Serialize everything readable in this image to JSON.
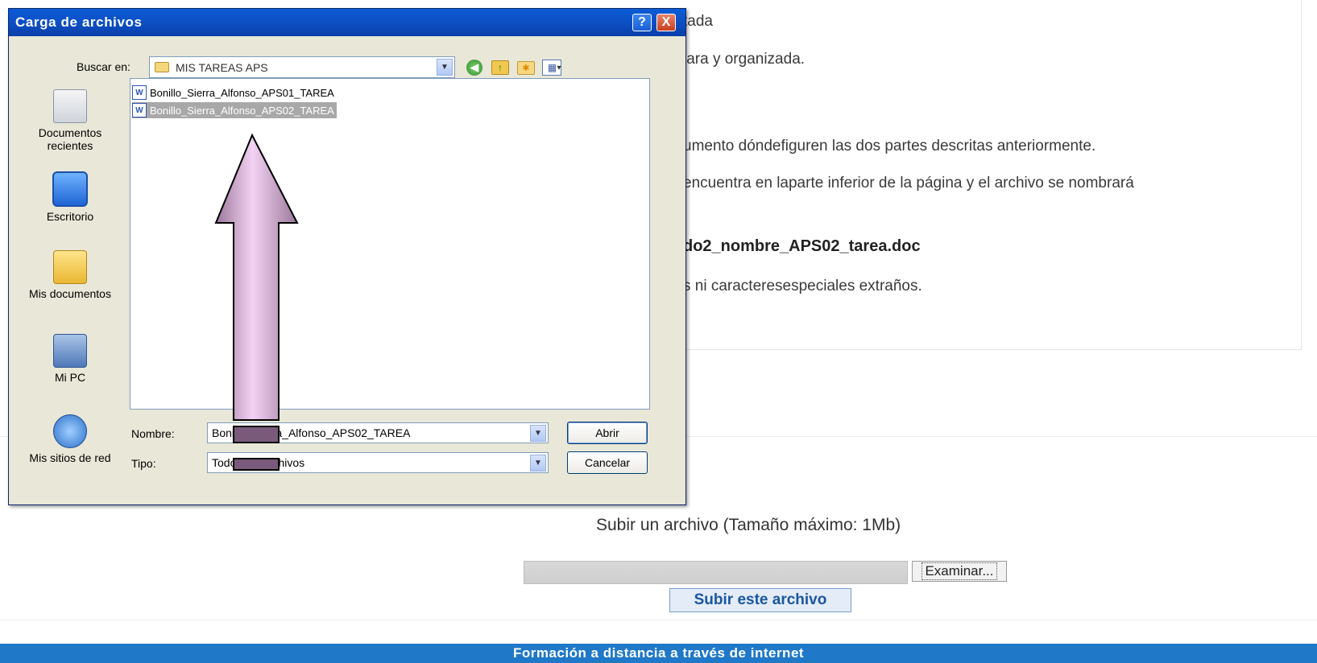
{
  "background_page": {
    "lines": [
      "tada",
      "lara y organizada.",
      "umento dóndefiguren las dos partes descritas anteriormente.",
      "encuentra en laparte inferior de la página y el archivo se nombrará",
      "do2_nombre_APS02_tarea.doc",
      "s ni caracteresespeciales extraños."
    ],
    "upload_label": "Subir un archivo (Tamaño máximo: 1Mb)",
    "browse_label": "Examinar...",
    "submit_label": "Subir este archivo",
    "footer_text": "Formación a distancia a través de internet"
  },
  "dialog": {
    "title": "Carga de archivos",
    "help_glyph": "?",
    "close_glyph": "X",
    "look_in_label": "Buscar en:",
    "look_in_value": "MIS TAREAS APS",
    "places": [
      {
        "label_1": "Documentos",
        "label_2": "recientes"
      },
      {
        "label_1": "Escritorio",
        "label_2": ""
      },
      {
        "label_1": "Mis documentos",
        "label_2": ""
      },
      {
        "label_1": "Mi PC",
        "label_2": ""
      },
      {
        "label_1": "Mis sitios de red",
        "label_2": ""
      }
    ],
    "files": [
      {
        "name": "Bonillo_Sierra_Alfonso_APS01_TAREA",
        "selected": false
      },
      {
        "name": "Bonillo_Sierra_Alfonso_APS02_TAREA",
        "selected": true
      }
    ],
    "filename_label": "Nombre:",
    "filename_value": "Bonillo_Sierra_Alfonso_APS02_TAREA",
    "filetype_label": "Tipo:",
    "filetype_value": "Todos los archivos",
    "open_label": "Abrir",
    "cancel_label": "Cancelar"
  },
  "colors": {
    "titlebar": "#0c4cbf",
    "footer": "#1f78c8",
    "submit_text": "#1a56a0",
    "arrow_fill": "#c9a3c9",
    "arrow_stroke": "#000000"
  }
}
